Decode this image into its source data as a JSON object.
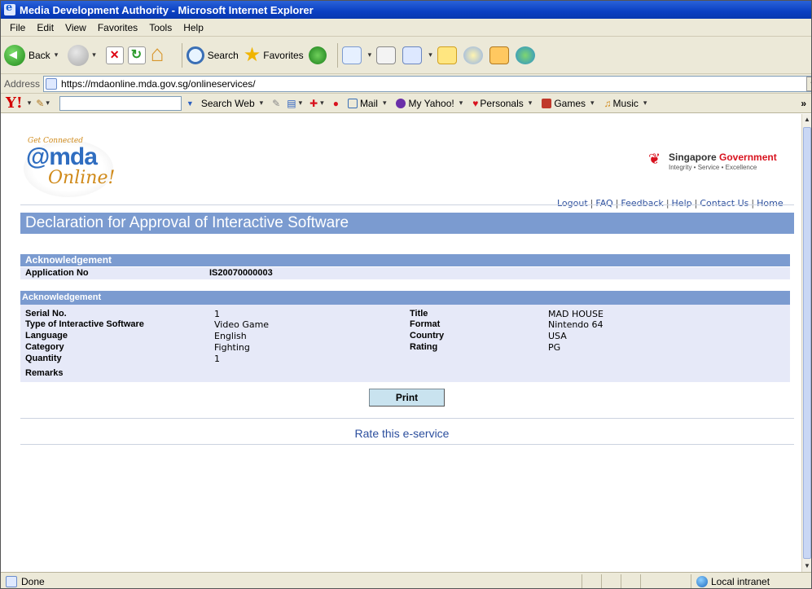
{
  "window": {
    "title": "Media Development Authority - Microsoft Internet Explorer"
  },
  "menu": [
    "File",
    "Edit",
    "View",
    "Favorites",
    "Tools",
    "Help"
  ],
  "toolbar": {
    "back_label": "Back",
    "search_label": "Search",
    "favorites_label": "Favorites"
  },
  "address": {
    "label": "Address",
    "url": "https://mdaonline.mda.gov.sg/onlineservices/"
  },
  "yahoo": {
    "logo": "Y!",
    "search_web": "Search Web",
    "mail": "Mail",
    "my_yahoo": "My Yahoo!",
    "personals": "Personals",
    "games": "Games",
    "music": "Music",
    "overflow": "»"
  },
  "logo": {
    "tagline": "Get Connected",
    "brand": "@mda",
    "online": "Online!"
  },
  "sg": {
    "name_prefix": "Singapore ",
    "name_highlight": "Government",
    "motto": "Integrity • Service • Excellence"
  },
  "links": [
    "Logout",
    "FAQ",
    "Feedback",
    "Help",
    "Contact Us",
    "Home"
  ],
  "page_title": "Declaration for Approval of Interactive Software",
  "ack1": {
    "heading": "Acknowledgement",
    "app_no_label": "Application No",
    "app_no_value": "IS20070000003"
  },
  "ack2": {
    "heading": "Acknowledgement",
    "left": [
      {
        "label": "Serial No.",
        "value": "1"
      },
      {
        "label": "Type of Interactive Software",
        "value": "Video Game"
      },
      {
        "label": "Language",
        "value": "English"
      },
      {
        "label": "Category",
        "value": "Fighting"
      },
      {
        "label": "Quantity",
        "value": "1"
      },
      {
        "label": "Remarks",
        "value": ""
      }
    ],
    "right": [
      {
        "label": "Title",
        "value": "MAD HOUSE"
      },
      {
        "label": "Format",
        "value": "Nintendo 64"
      },
      {
        "label": "Country",
        "value": "USA"
      },
      {
        "label": "Rating",
        "value": "PG"
      }
    ]
  },
  "print_label": "Print",
  "rate_label": "Rate this e-service",
  "status": {
    "text": "Done",
    "zone": "Local intranet"
  },
  "colors": {
    "title_bar": "#0a3fc2",
    "section_header": "#7b9bd0",
    "section_body": "#e6e9f8",
    "link": "#2c4f9e",
    "button": "#c9e3ef"
  }
}
